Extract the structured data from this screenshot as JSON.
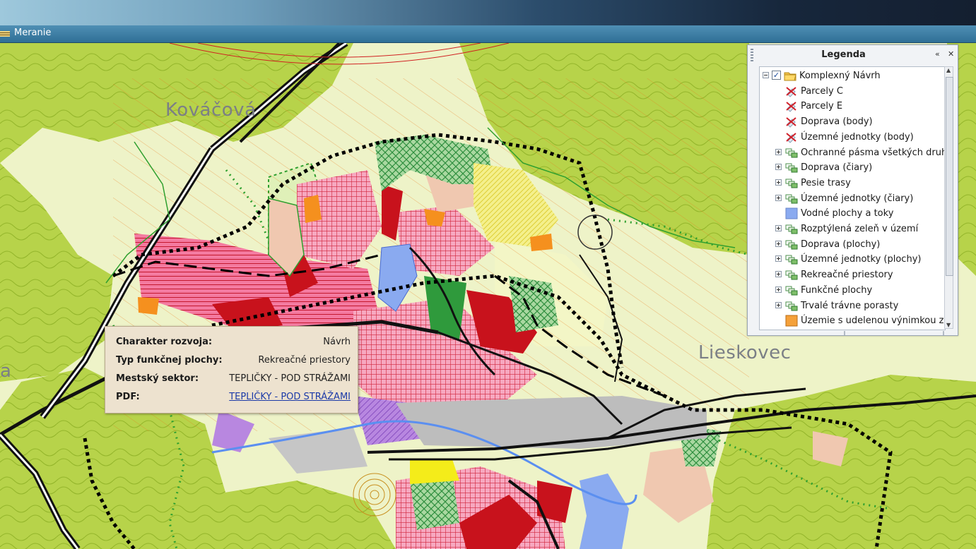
{
  "window": {
    "title": "Meranie"
  },
  "map": {
    "towns": [
      "Kováčová",
      "Lieskovec",
      "a"
    ]
  },
  "popup": {
    "rows": [
      {
        "label": "Charakter rozvoja:",
        "value": "Návrh"
      },
      {
        "label": "Typ funkčnej plochy:",
        "value": "Rekreačné priestory"
      },
      {
        "label": "Mestský sektor:",
        "value": "TEPLIČKY - POD STRÁŽAMI"
      },
      {
        "label": "PDF:",
        "value": "TEPLIČKY - POD STRÁŽAMI"
      }
    ]
  },
  "legend": {
    "title": "Legenda",
    "collapse_icon": "«",
    "close_icon": "✕",
    "items": [
      {
        "label": "Komplexný Návrh",
        "icon": "folder-icon",
        "level": 0,
        "expand": "minus",
        "checked": true
      },
      {
        "label": "Parcely C",
        "icon": "layer-disabled-icon",
        "level": 1
      },
      {
        "label": "Parcely E",
        "icon": "layer-disabled-icon",
        "level": 1
      },
      {
        "label": "Doprava (body)",
        "icon": "layer-disabled-icon",
        "level": 1
      },
      {
        "label": "Územné jednotky (body)",
        "icon": "layer-disabled-icon",
        "level": 1
      },
      {
        "label": "Ochranné pásma všetkých druhov",
        "icon": "layer-group-icon",
        "level": 1,
        "expand": "plus"
      },
      {
        "label": "Doprava (čiary)",
        "icon": "layer-group-icon",
        "level": 1,
        "expand": "plus"
      },
      {
        "label": "Pesie trasy",
        "icon": "layer-group-icon",
        "level": 1,
        "expand": "plus"
      },
      {
        "label": "Územné jednotky (čiary)",
        "icon": "layer-group-icon",
        "level": 1,
        "expand": "plus"
      },
      {
        "label": "Vodné plochy a toky",
        "icon": "water-swatch-icon",
        "level": 1,
        "color": "#8aaaf0"
      },
      {
        "label": "Rozptýlená zeleň v území",
        "icon": "layer-group-icon",
        "level": 1,
        "expand": "plus"
      },
      {
        "label": "Doprava (plochy)",
        "icon": "layer-group-icon",
        "level": 1,
        "expand": "plus"
      },
      {
        "label": "Územné jednotky (plochy)",
        "icon": "layer-group-icon",
        "level": 1,
        "expand": "plus"
      },
      {
        "label": "Rekreačné priestory",
        "icon": "layer-group-icon",
        "level": 1,
        "expand": "plus"
      },
      {
        "label": "Funkčné plochy",
        "icon": "layer-group-icon",
        "level": 1,
        "expand": "plus"
      },
      {
        "label": "Trvalé trávne porasty",
        "icon": "layer-group-icon",
        "level": 1,
        "expand": "plus"
      },
      {
        "label": "Územie s udelenou výnimkou z uzávery",
        "icon": "exception-swatch-icon",
        "level": 1,
        "color": "#f5a13a"
      }
    ]
  }
}
